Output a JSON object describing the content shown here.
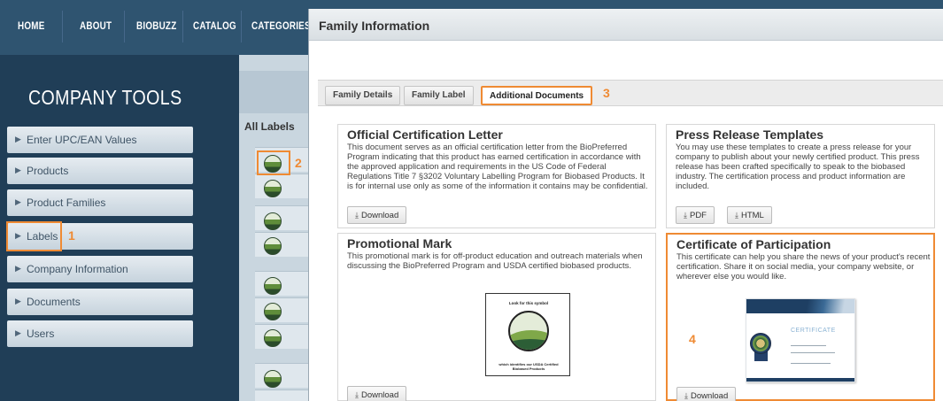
{
  "top_nav": {
    "items": [
      "HOME",
      "ABOUT",
      "BIOBUZZ",
      "CATALOG",
      "CATEGORIES"
    ]
  },
  "sidebar": {
    "title": "COMPANY TOOLS",
    "items": [
      {
        "label": "Enter UPC/EAN Values"
      },
      {
        "label": "Products"
      },
      {
        "label": "Product Families"
      },
      {
        "label": "Labels"
      },
      {
        "label": "Company Information"
      },
      {
        "label": "Documents"
      },
      {
        "label": "Users"
      }
    ]
  },
  "labels_list": {
    "header": "All Labels"
  },
  "modal": {
    "title": "Family Information",
    "tabs": [
      {
        "label": "Family Details",
        "active": false
      },
      {
        "label": "Family Label",
        "active": false
      },
      {
        "label": "Additional Documents",
        "active": true
      }
    ],
    "cards": {
      "certification_letter": {
        "title": "Official Certification Letter",
        "description": "This document serves as an official certification letter from the BioPreferred Program indicating that this product has earned certification in accordance with the approved application and requirements in the US Code of Federal Regulations Title 7 §3202 Voluntary Labelling Program for Biobased Products. It is for internal use only as some of the information it contains may be confidential.",
        "download_label": "Download"
      },
      "press_release": {
        "title": "Press Release Templates",
        "description": "You may use these templates to create a press release for your company to publish about your newly certified product. This press release has been crafted specifically to speak to the biobased industry. The certification process and product information are included.",
        "pdf_label": "PDF",
        "html_label": "HTML"
      },
      "promotional_mark": {
        "title": "Promotional Mark",
        "description": "This promotional mark is for off-product education and outreach materials when discussing the BioPreferred Program and USDA certified biobased products.",
        "image_top_text": "Look for this symbol",
        "image_bottom_text": "which identifies our USDA Certified Biobased Products",
        "download_label": "Download"
      },
      "certificate": {
        "title": "Certificate of Participation",
        "description": "This certificate can help you share the news of your product's recent certification. Share it on social media, your company website, or wherever else you would like.",
        "image_heading": "CERTIFICATE",
        "download_label": "Download"
      }
    }
  },
  "callouts": [
    "1",
    "2",
    "3",
    "4"
  ],
  "colors": {
    "callout": "#ef8a33",
    "nav_bg": "#2f5470",
    "sidebar_bg": "#203e57"
  },
  "icons": {
    "sidebar_caret": "caret-right-icon",
    "download": "download-icon"
  }
}
